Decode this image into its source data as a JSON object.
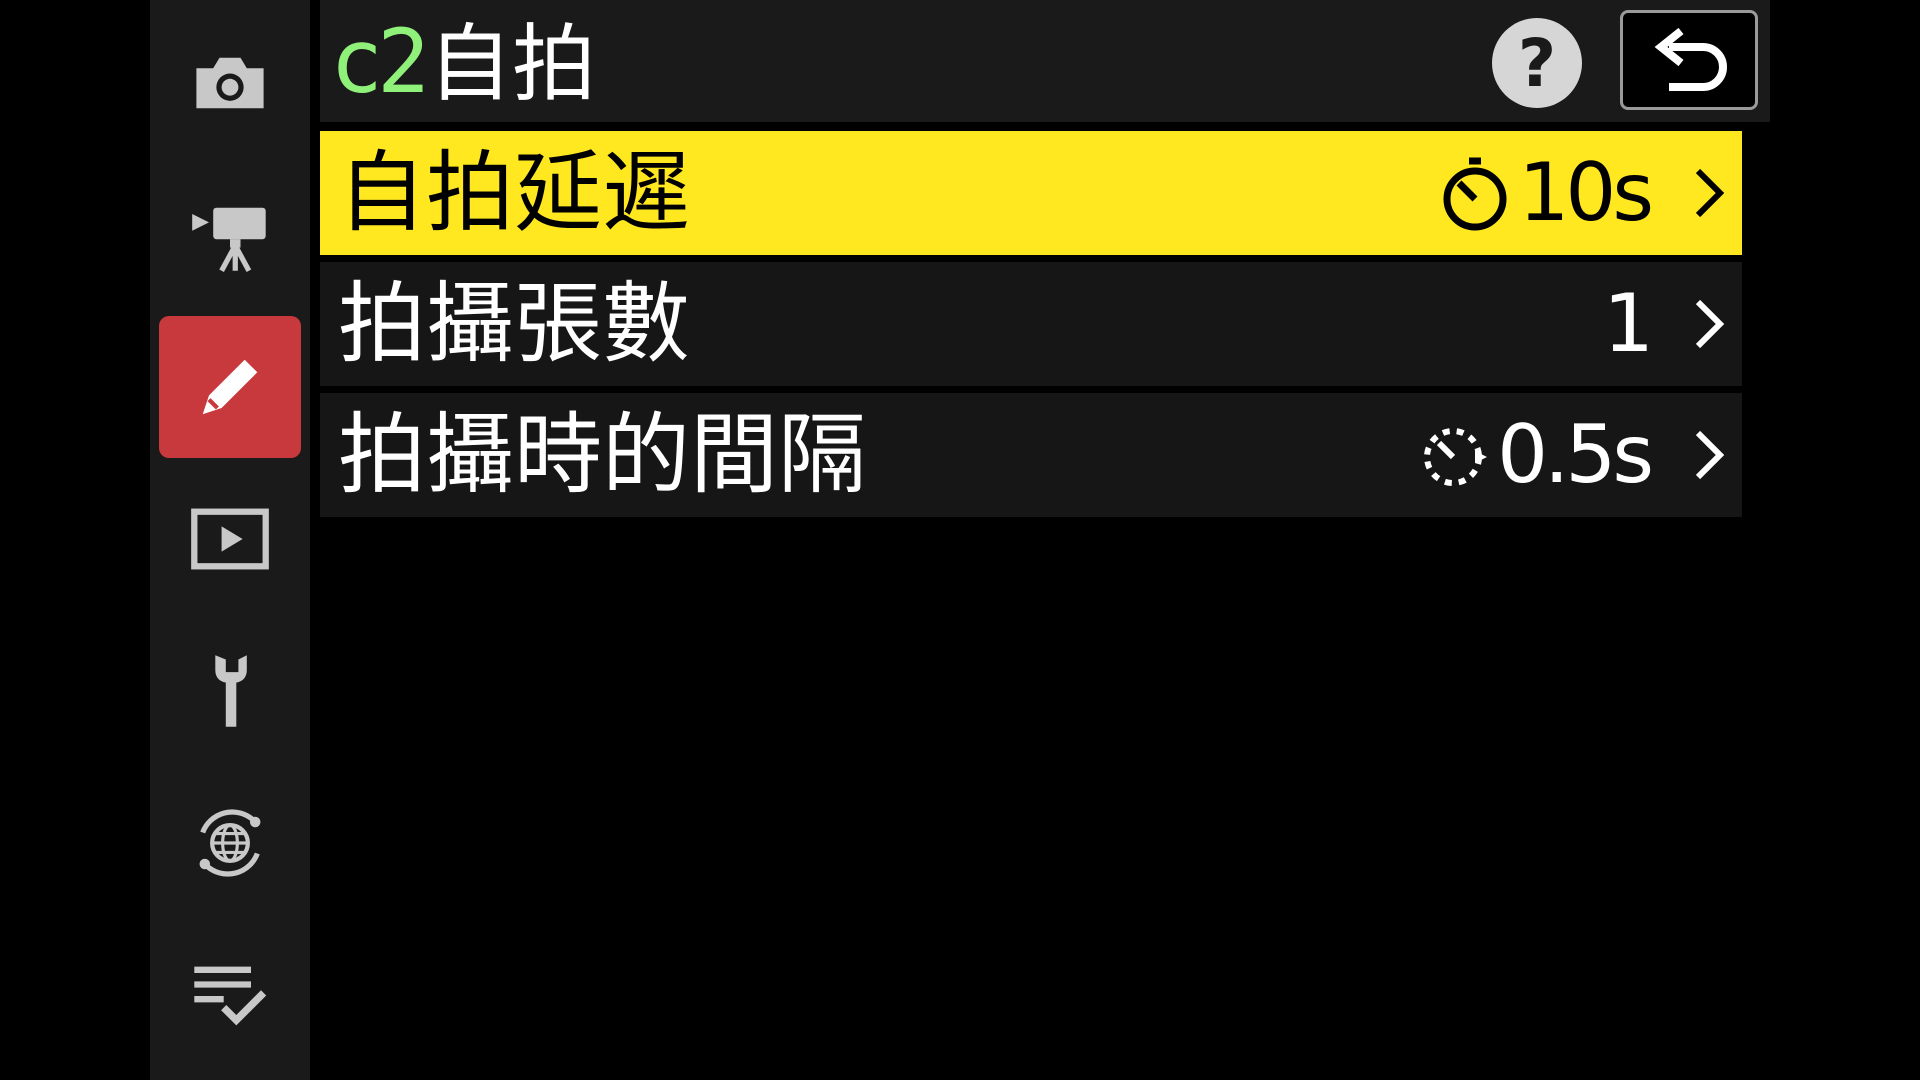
{
  "sidebar": {
    "items": [
      {
        "icon": "camera-icon",
        "name": "sidebar-item-photo"
      },
      {
        "icon": "movie-camera-icon",
        "name": "sidebar-item-movie"
      },
      {
        "icon": "pencil-icon",
        "name": "sidebar-item-custom",
        "active": true
      },
      {
        "icon": "playback-icon",
        "name": "sidebar-item-playback"
      },
      {
        "icon": "wrench-icon",
        "name": "sidebar-item-setup"
      },
      {
        "icon": "network-globe-icon",
        "name": "sidebar-item-network"
      },
      {
        "icon": "my-menu-checklist-icon",
        "name": "sidebar-item-my-menu"
      }
    ],
    "active_color": "#c8393d"
  },
  "header": {
    "code": "c2",
    "title": "自拍",
    "help_label": "?",
    "back_icon": "return-arrow-icon"
  },
  "menu": {
    "items": [
      {
        "label": "自拍延遲",
        "value": "10s",
        "value_icon": "self-timer-icon",
        "selected": true
      },
      {
        "label": "拍攝張數",
        "value": "1"
      },
      {
        "label": "拍攝時的間隔",
        "value": "0.5s",
        "value_icon": "interval-timer-icon"
      }
    ]
  },
  "colors": {
    "selection": "#ffe81f",
    "code": "#8ff07a",
    "row_bg": "#161616"
  }
}
